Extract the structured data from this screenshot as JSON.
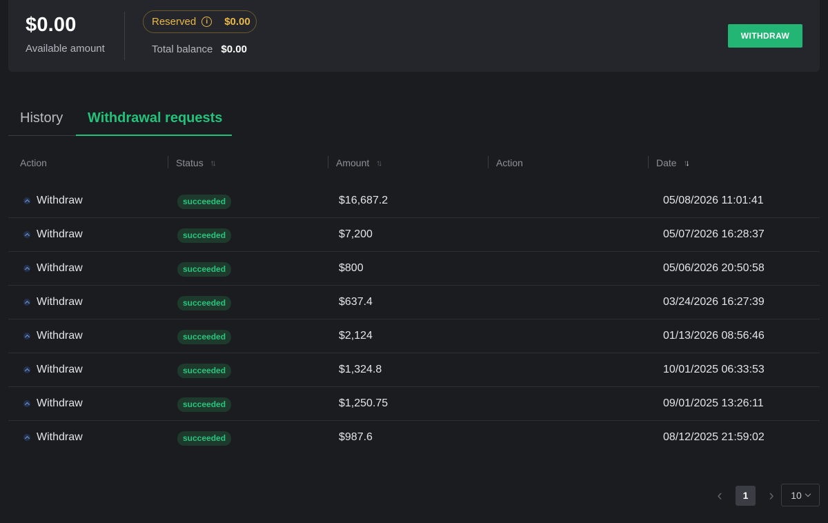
{
  "balance": {
    "available_amount": "$0.00",
    "available_label": "Available amount",
    "reserved_label": "Reserved",
    "reserved_value": "$0.00",
    "total_label": "Total balance",
    "total_value": "$0.00",
    "withdraw_button": "WITHDRAW"
  },
  "tabs": {
    "history": "History",
    "withdrawal_requests": "Withdrawal requests",
    "active": "withdrawal_requests"
  },
  "table": {
    "headers": [
      "Action",
      "Status",
      "Amount",
      "Action",
      "Date"
    ],
    "rows": [
      {
        "action": "Withdraw",
        "status": "succeeded",
        "amount": "$16,687.2",
        "date": "05/08/2026 11:01:41"
      },
      {
        "action": "Withdraw",
        "status": "succeeded",
        "amount": "$7,200",
        "date": "05/07/2026 16:28:37"
      },
      {
        "action": "Withdraw",
        "status": "succeeded",
        "amount": "$800",
        "date": "05/06/2026 20:50:58"
      },
      {
        "action": "Withdraw",
        "status": "succeeded",
        "amount": "$637.4",
        "date": "03/24/2026 16:27:39"
      },
      {
        "action": "Withdraw",
        "status": "succeeded",
        "amount": "$2,124",
        "date": "01/13/2026 08:56:46"
      },
      {
        "action": "Withdraw",
        "status": "succeeded",
        "amount": "$1,324.8",
        "date": "10/01/2025 06:33:53"
      },
      {
        "action": "Withdraw",
        "status": "succeeded",
        "amount": "$1,250.75",
        "date": "09/01/2025 13:26:11"
      },
      {
        "action": "Withdraw",
        "status": "succeeded",
        "amount": "$987.6",
        "date": "08/12/2025 21:59:02"
      }
    ]
  },
  "pagination": {
    "current_page": "1",
    "page_size": "10"
  },
  "colors": {
    "background": "#1a1c20",
    "card": "#24262b",
    "accent_green": "#22c27a",
    "reserved_gold": "#e9b949"
  },
  "icons": {
    "reserved_info": "info-icon",
    "row_action": "arrow-up-icon",
    "sort": "sort-icon",
    "prev": "chevron-left-icon",
    "next": "chevron-right-icon",
    "page_size": "chevron-down-icon"
  }
}
